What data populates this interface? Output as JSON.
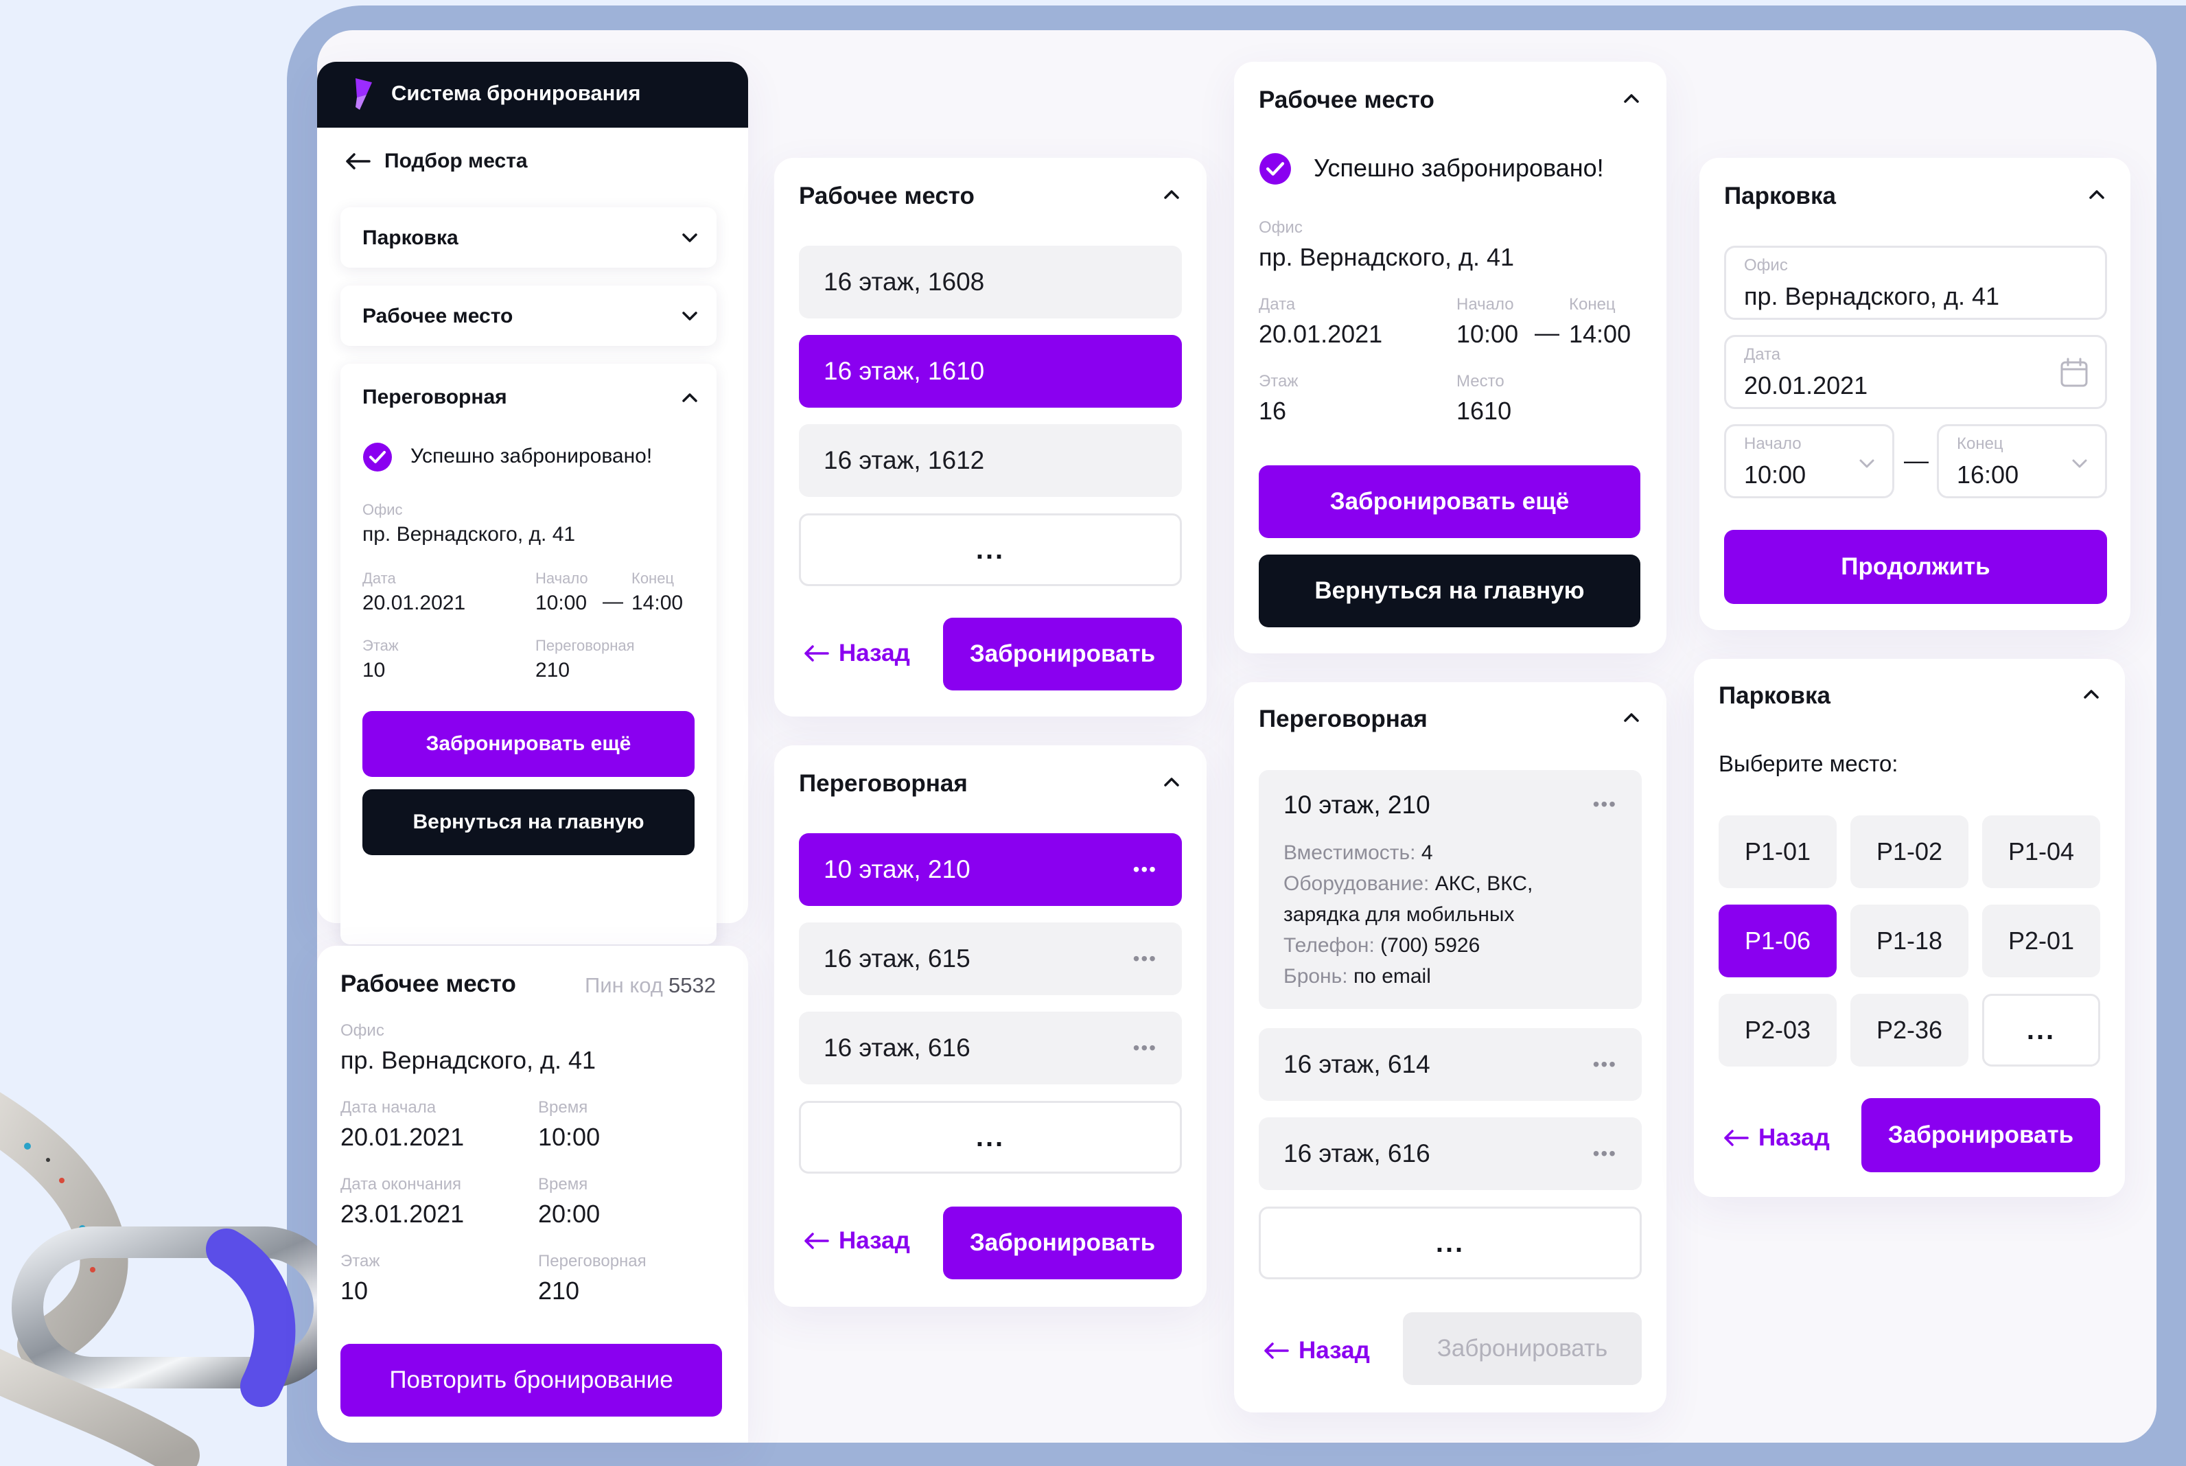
{
  "colors": {
    "accent": "#8a00f0",
    "dark": "#0c111d",
    "muted": "#b8b7c2"
  },
  "panel1": {
    "app_title": "Система бронирования",
    "nav_title": "Подбор места",
    "acc_parking": "Парковка",
    "acc_workplace": "Рабочее место",
    "acc_meeting": "Переговорная",
    "success": "Успешно забронировано!",
    "office_label": "Офис",
    "office": "пр. Вернадского, д. 41",
    "date_label": "Дата",
    "date": "20.01.2021",
    "start_label": "Начало",
    "start": "10:00",
    "end_label": "Конец",
    "end": "14:00",
    "dash": "—",
    "floor_label": "Этаж",
    "floor": "10",
    "room_label": "Переговорная",
    "room": "210",
    "btn_more": "Забронировать ещё",
    "btn_home": "Вернуться на главную"
  },
  "panel1b": {
    "title": "Рабочее место",
    "pin_label": "Пин код",
    "pin": "5532",
    "office_label": "Офис",
    "office": "пр. Вернадского, д. 41",
    "date_start_label": "Дата начала",
    "date_start": "20.01.2021",
    "time1_label": "Время",
    "time1": "10:00",
    "date_end_label": "Дата окончания",
    "date_end": "23.01.2021",
    "time2_label": "Время",
    "time2": "20:00",
    "floor_label": "Этаж",
    "floor": "10",
    "room_label": "Переговорная",
    "room": "210",
    "btn_repeat": "Повторить бронирование"
  },
  "panel2": {
    "title": "Рабочее место",
    "options": [
      "16 этаж, 1608",
      "16 этаж, 1610",
      "16 этаж, 1612"
    ],
    "more": "...",
    "back": "Назад",
    "book": "Забронировать"
  },
  "panel2b": {
    "title": "Переговорная",
    "options": [
      "10 этаж, 210",
      "16 этаж, 615",
      "16 этаж, 616"
    ],
    "more": "...",
    "back": "Назад",
    "book": "Забронировать"
  },
  "panel3": {
    "title": "Рабочее место",
    "success": "Успешно забронировано!",
    "office_label": "Офис",
    "office": "пр. Вернадского, д. 41",
    "date_label": "Дата",
    "date": "20.01.2021",
    "start_label": "Начало",
    "start": "10:00",
    "end_label": "Конец",
    "end": "14:00",
    "dash": "—",
    "floor_label": "Этаж",
    "floor": "16",
    "place_label": "Место",
    "place": "1610",
    "btn_more": "Забронировать ещё",
    "btn_home": "Вернуться на главную"
  },
  "panel3b": {
    "title": "Переговорная",
    "expanded": {
      "name": "10 этаж, 210",
      "cap_label": "Вместимость:",
      "cap": "4",
      "equip_label": "Оборудование:",
      "equip": "АКС, ВКС,",
      "equip2": "зарядка для мобильных",
      "phone_label": "Телефон:",
      "phone": "(700) 5926",
      "booking_label": "Бронь:",
      "booking": "по email"
    },
    "options": [
      "16 этаж, 614",
      "16 этаж, 616"
    ],
    "more": "...",
    "back": "Назад",
    "book": "Забронировать"
  },
  "panel4": {
    "title": "Парковка",
    "office_label": "Офис",
    "office": "пр. Вернадского, д. 41",
    "date_label": "Дата",
    "date": "20.01.2021",
    "start_label": "Начало",
    "start": "10:00",
    "end_label": "Конец",
    "end": "16:00",
    "dash": "—",
    "continue": "Продолжить"
  },
  "panel4b": {
    "title": "Парковка",
    "prompt": "Выберите место:",
    "spots": [
      "P1-01",
      "P1-02",
      "P1-04",
      "P1-06",
      "P1-18",
      "P2-01",
      "P2-03",
      "P2-36"
    ],
    "more": "...",
    "back": "Назад",
    "book": "Забронировать"
  }
}
